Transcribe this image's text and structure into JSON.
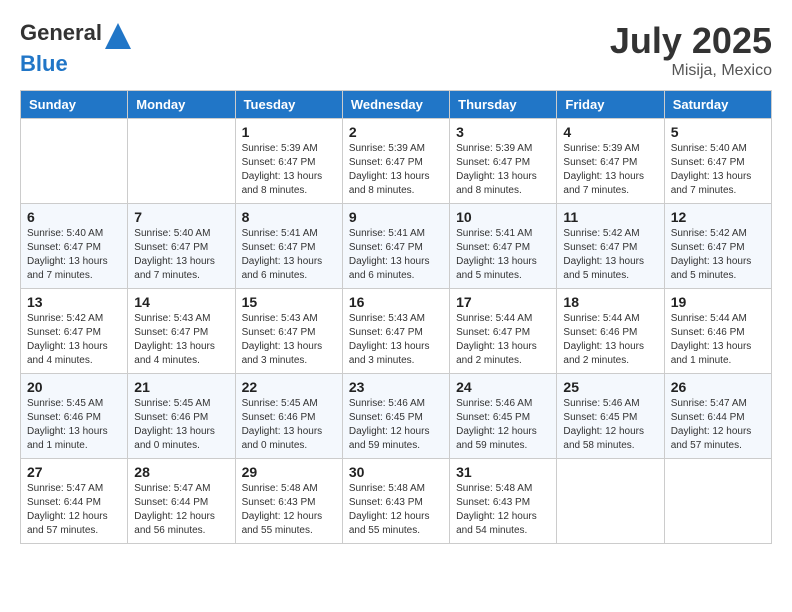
{
  "header": {
    "logo_general": "General",
    "logo_blue": "Blue",
    "month": "July 2025",
    "location": "Misija, Mexico"
  },
  "days_of_week": [
    "Sunday",
    "Monday",
    "Tuesday",
    "Wednesday",
    "Thursday",
    "Friday",
    "Saturday"
  ],
  "weeks": [
    [
      {
        "day": "",
        "info": ""
      },
      {
        "day": "",
        "info": ""
      },
      {
        "day": "1",
        "info": "Sunrise: 5:39 AM\nSunset: 6:47 PM\nDaylight: 13 hours and 8 minutes."
      },
      {
        "day": "2",
        "info": "Sunrise: 5:39 AM\nSunset: 6:47 PM\nDaylight: 13 hours and 8 minutes."
      },
      {
        "day": "3",
        "info": "Sunrise: 5:39 AM\nSunset: 6:47 PM\nDaylight: 13 hours and 8 minutes."
      },
      {
        "day": "4",
        "info": "Sunrise: 5:39 AM\nSunset: 6:47 PM\nDaylight: 13 hours and 7 minutes."
      },
      {
        "day": "5",
        "info": "Sunrise: 5:40 AM\nSunset: 6:47 PM\nDaylight: 13 hours and 7 minutes."
      }
    ],
    [
      {
        "day": "6",
        "info": "Sunrise: 5:40 AM\nSunset: 6:47 PM\nDaylight: 13 hours and 7 minutes."
      },
      {
        "day": "7",
        "info": "Sunrise: 5:40 AM\nSunset: 6:47 PM\nDaylight: 13 hours and 7 minutes."
      },
      {
        "day": "8",
        "info": "Sunrise: 5:41 AM\nSunset: 6:47 PM\nDaylight: 13 hours and 6 minutes."
      },
      {
        "day": "9",
        "info": "Sunrise: 5:41 AM\nSunset: 6:47 PM\nDaylight: 13 hours and 6 minutes."
      },
      {
        "day": "10",
        "info": "Sunrise: 5:41 AM\nSunset: 6:47 PM\nDaylight: 13 hours and 5 minutes."
      },
      {
        "day": "11",
        "info": "Sunrise: 5:42 AM\nSunset: 6:47 PM\nDaylight: 13 hours and 5 minutes."
      },
      {
        "day": "12",
        "info": "Sunrise: 5:42 AM\nSunset: 6:47 PM\nDaylight: 13 hours and 5 minutes."
      }
    ],
    [
      {
        "day": "13",
        "info": "Sunrise: 5:42 AM\nSunset: 6:47 PM\nDaylight: 13 hours and 4 minutes."
      },
      {
        "day": "14",
        "info": "Sunrise: 5:43 AM\nSunset: 6:47 PM\nDaylight: 13 hours and 4 minutes."
      },
      {
        "day": "15",
        "info": "Sunrise: 5:43 AM\nSunset: 6:47 PM\nDaylight: 13 hours and 3 minutes."
      },
      {
        "day": "16",
        "info": "Sunrise: 5:43 AM\nSunset: 6:47 PM\nDaylight: 13 hours and 3 minutes."
      },
      {
        "day": "17",
        "info": "Sunrise: 5:44 AM\nSunset: 6:47 PM\nDaylight: 13 hours and 2 minutes."
      },
      {
        "day": "18",
        "info": "Sunrise: 5:44 AM\nSunset: 6:46 PM\nDaylight: 13 hours and 2 minutes."
      },
      {
        "day": "19",
        "info": "Sunrise: 5:44 AM\nSunset: 6:46 PM\nDaylight: 13 hours and 1 minute."
      }
    ],
    [
      {
        "day": "20",
        "info": "Sunrise: 5:45 AM\nSunset: 6:46 PM\nDaylight: 13 hours and 1 minute."
      },
      {
        "day": "21",
        "info": "Sunrise: 5:45 AM\nSunset: 6:46 PM\nDaylight: 13 hours and 0 minutes."
      },
      {
        "day": "22",
        "info": "Sunrise: 5:45 AM\nSunset: 6:46 PM\nDaylight: 13 hours and 0 minutes."
      },
      {
        "day": "23",
        "info": "Sunrise: 5:46 AM\nSunset: 6:45 PM\nDaylight: 12 hours and 59 minutes."
      },
      {
        "day": "24",
        "info": "Sunrise: 5:46 AM\nSunset: 6:45 PM\nDaylight: 12 hours and 59 minutes."
      },
      {
        "day": "25",
        "info": "Sunrise: 5:46 AM\nSunset: 6:45 PM\nDaylight: 12 hours and 58 minutes."
      },
      {
        "day": "26",
        "info": "Sunrise: 5:47 AM\nSunset: 6:44 PM\nDaylight: 12 hours and 57 minutes."
      }
    ],
    [
      {
        "day": "27",
        "info": "Sunrise: 5:47 AM\nSunset: 6:44 PM\nDaylight: 12 hours and 57 minutes."
      },
      {
        "day": "28",
        "info": "Sunrise: 5:47 AM\nSunset: 6:44 PM\nDaylight: 12 hours and 56 minutes."
      },
      {
        "day": "29",
        "info": "Sunrise: 5:48 AM\nSunset: 6:43 PM\nDaylight: 12 hours and 55 minutes."
      },
      {
        "day": "30",
        "info": "Sunrise: 5:48 AM\nSunset: 6:43 PM\nDaylight: 12 hours and 55 minutes."
      },
      {
        "day": "31",
        "info": "Sunrise: 5:48 AM\nSunset: 6:43 PM\nDaylight: 12 hours and 54 minutes."
      },
      {
        "day": "",
        "info": ""
      },
      {
        "day": "",
        "info": ""
      }
    ]
  ]
}
